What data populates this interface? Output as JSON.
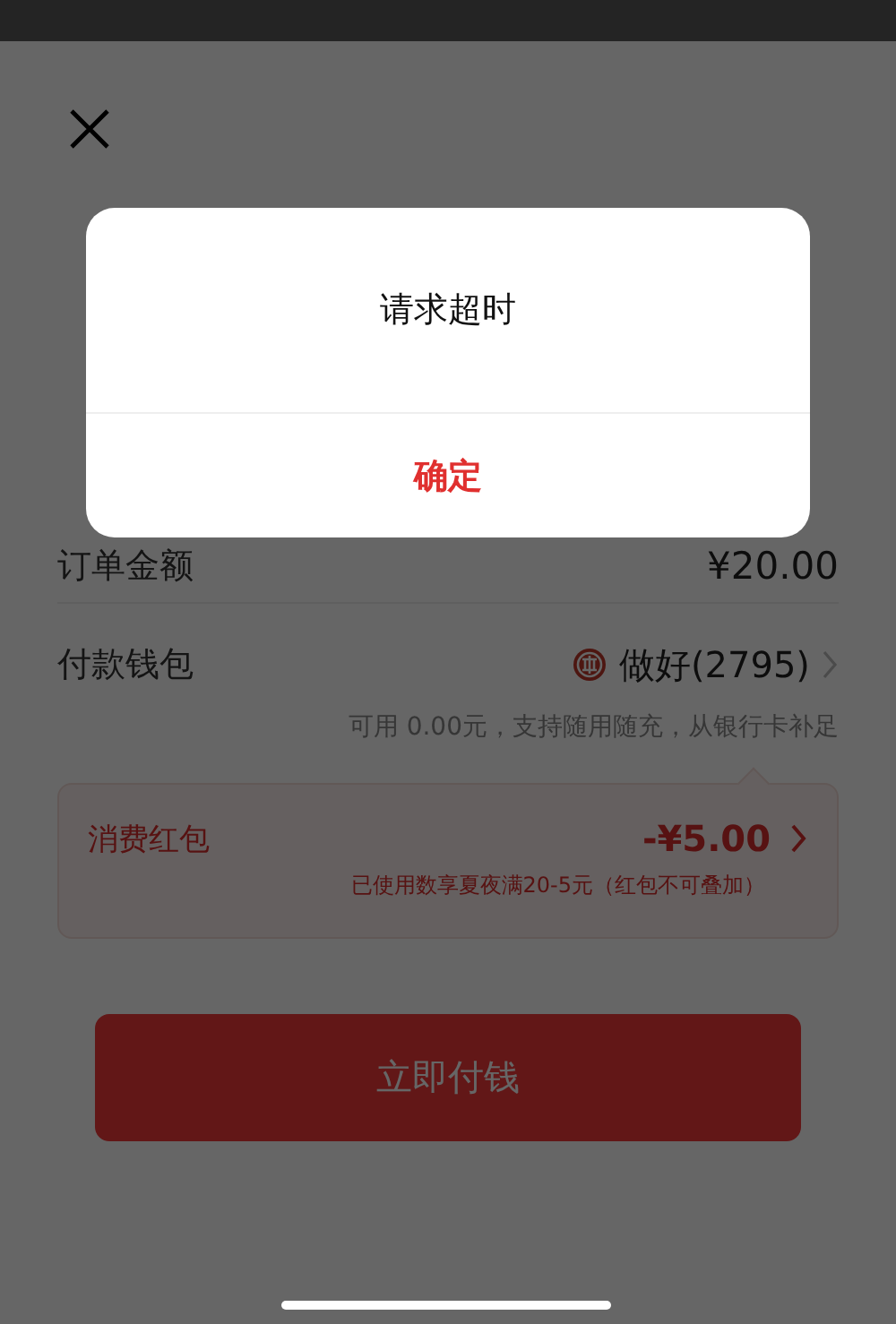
{
  "order": {
    "label": "订单金额",
    "amount": "¥20.00"
  },
  "wallet": {
    "label": "付款钱包",
    "name": "做好(2795)",
    "hint": "可用 0.00元，支持随用随充，从银行卡补足"
  },
  "red_packet": {
    "label": "消费红包",
    "amount": "-¥5.00",
    "note": "已使用数享夏夜满20-5元（红包不可叠加）"
  },
  "pay_button": "立即付钱",
  "dialog": {
    "title": "请求超时",
    "confirm": "确定"
  }
}
